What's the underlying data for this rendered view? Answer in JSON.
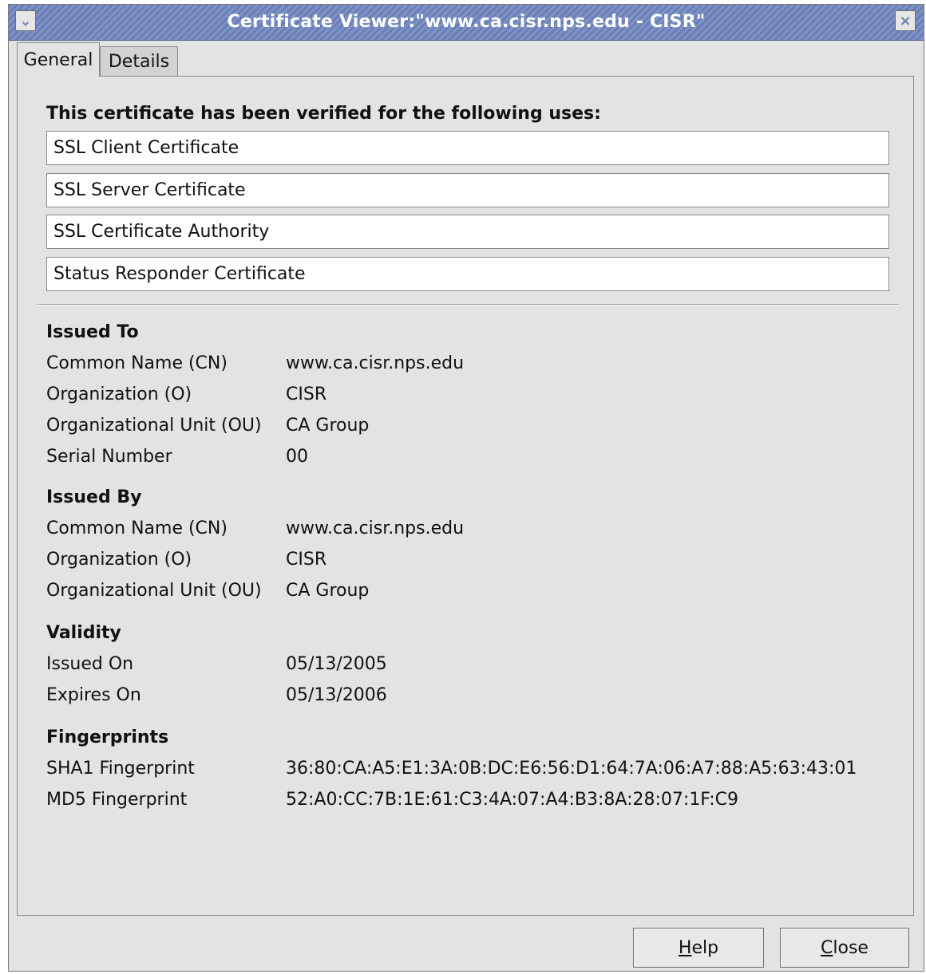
{
  "window": {
    "title": "Certificate Viewer:\"www.ca.cisr.nps.edu - CISR\"",
    "accent_color": "#6a7fb6"
  },
  "tabs": [
    {
      "label": "General",
      "active": true
    },
    {
      "label": "Details",
      "active": false
    }
  ],
  "uses": {
    "heading": "This certificate has been verified for the following uses:",
    "items": [
      "SSL Client Certificate",
      "SSL Server Certificate",
      "SSL Certificate Authority",
      "Status Responder Certificate"
    ]
  },
  "issued_to": {
    "title": "Issued To",
    "rows": [
      {
        "label": "Common Name (CN)",
        "value": "www.ca.cisr.nps.edu"
      },
      {
        "label": "Organization (O)",
        "value": "CISR"
      },
      {
        "label": "Organizational Unit (OU)",
        "value": "CA Group"
      },
      {
        "label": "Serial Number",
        "value": "00"
      }
    ]
  },
  "issued_by": {
    "title": "Issued By",
    "rows": [
      {
        "label": "Common Name (CN)",
        "value": "www.ca.cisr.nps.edu"
      },
      {
        "label": "Organization (O)",
        "value": "CISR"
      },
      {
        "label": "Organizational Unit (OU)",
        "value": "CA Group"
      }
    ]
  },
  "validity": {
    "title": "Validity",
    "rows": [
      {
        "label": "Issued On",
        "value": "05/13/2005"
      },
      {
        "label": "Expires On",
        "value": "05/13/2006"
      }
    ]
  },
  "fingerprints": {
    "title": "Fingerprints",
    "rows": [
      {
        "label": "SHA1 Fingerprint",
        "value": "36:80:CA:A5:E1:3A:0B:DC:E6:56:D1:64:7A:06:A7:88:A5:63:43:01"
      },
      {
        "label": "MD5 Fingerprint",
        "value": "52:A0:CC:7B:1E:61:C3:4A:07:A4:B3:8A:28:07:1F:C9"
      }
    ]
  },
  "buttons": {
    "help_first": "H",
    "help_rest": "elp",
    "close_first": "C",
    "close_rest": "lose"
  }
}
